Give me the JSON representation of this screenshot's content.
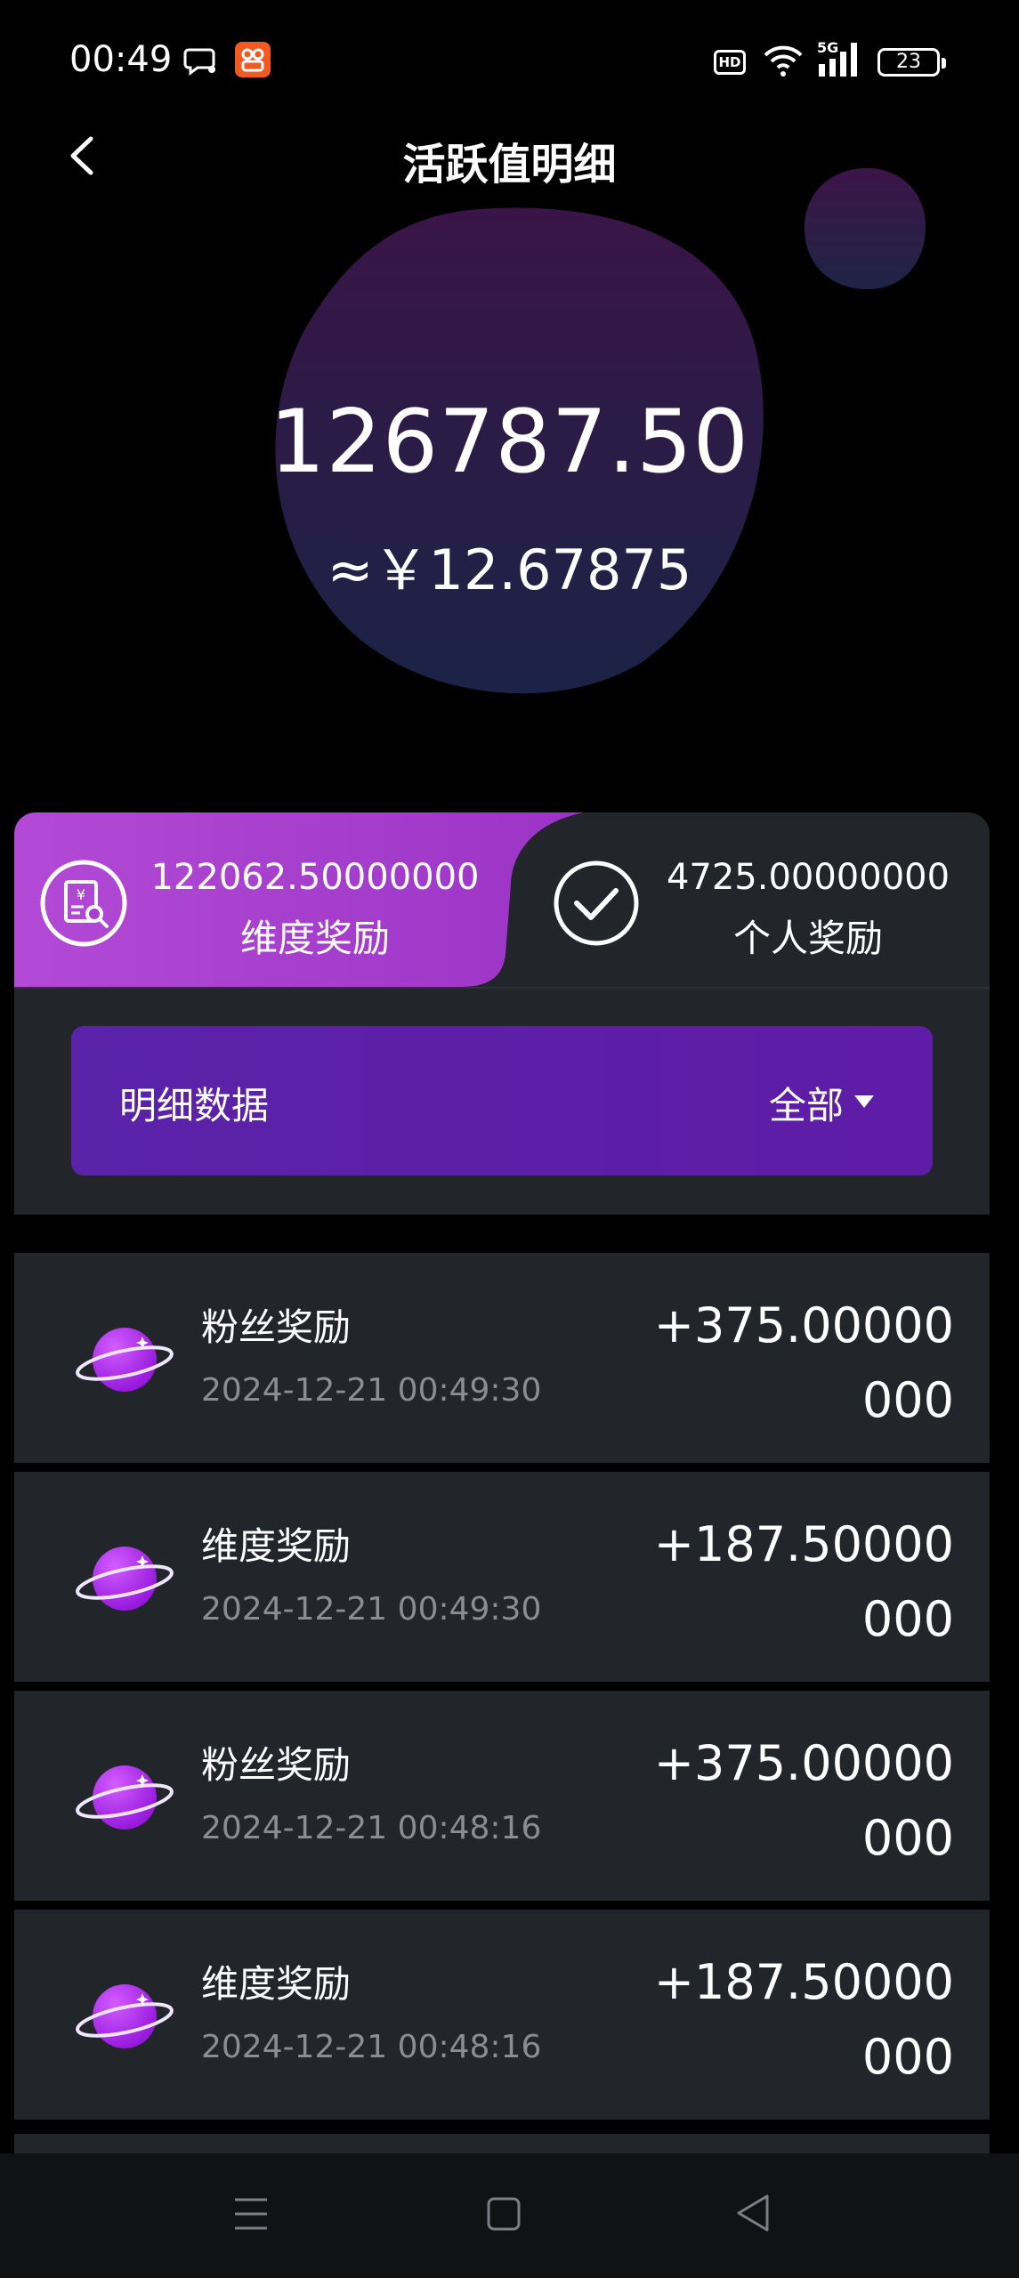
{
  "status_bar": {
    "time": "00:49",
    "hd_badge": "HD",
    "network": "5G",
    "battery": "23"
  },
  "header": {
    "title": "活跃值明细"
  },
  "summary": {
    "total": "126787.50",
    "cny_equivalent": "≈￥12.67875"
  },
  "rewards": {
    "dimension": {
      "value": "122062.50000000",
      "label": "维度奖励",
      "icon": "receipt-search-icon"
    },
    "personal": {
      "value": "4725.00000000",
      "label": "个人奖励",
      "icon": "check-circle-icon"
    }
  },
  "filter": {
    "label": "明细数据",
    "selected": "全部"
  },
  "records": [
    {
      "title": "粉丝奖励",
      "time": "2024-12-21 00:49:30",
      "amount": "+375.00000000"
    },
    {
      "title": "维度奖励",
      "time": "2024-12-21 00:49:30",
      "amount": "+187.50000000"
    },
    {
      "title": "粉丝奖励",
      "time": "2024-12-21 00:48:16",
      "amount": "+375.00000000"
    },
    {
      "title": "维度奖励",
      "time": "2024-12-21 00:48:16",
      "amount": "+187.50000000"
    }
  ],
  "colors": {
    "accent_purple": "#a043c8",
    "filter_bg": "#5a23a8",
    "card_bg": "#22252a",
    "planet": "#b017e8"
  }
}
